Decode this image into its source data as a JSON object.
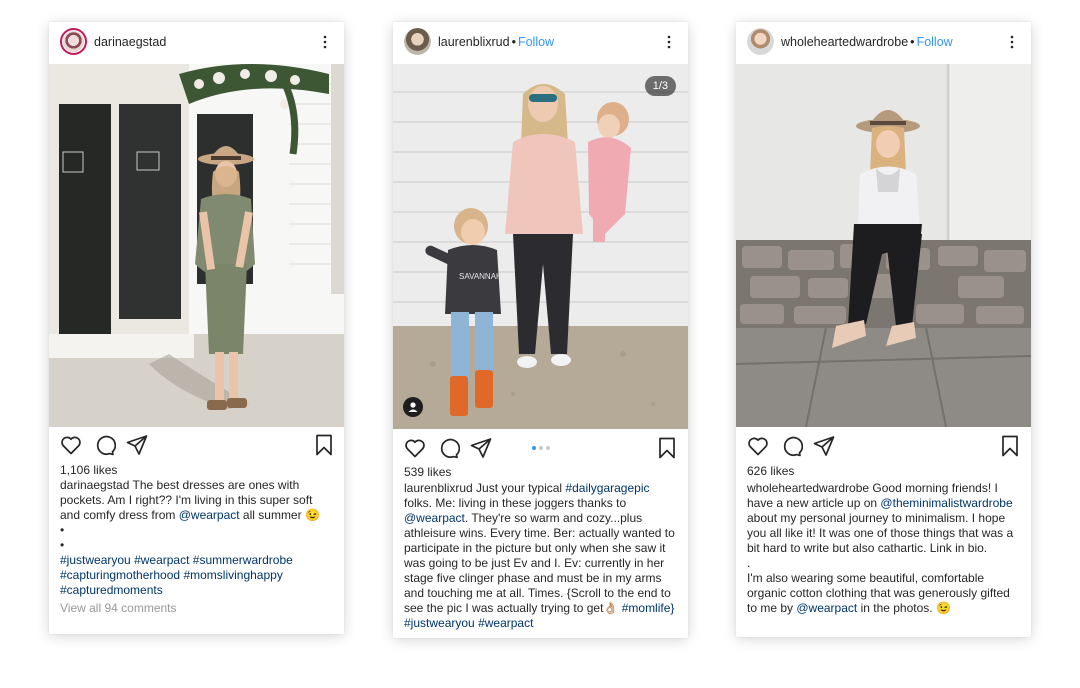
{
  "posts": [
    {
      "username": "darinaegstad",
      "follow": "",
      "likes": "1,106 likes",
      "caption": {
        "user": "darinaegstad",
        "t1": " The best dresses are ones with pockets. Am I right?? I'm living in this super soft and comfy dress from ",
        "mention": "@wearpact",
        "t2": " all summer 😉",
        "dot1": "•",
        "dot2": "•",
        "tags": [
          "#justwearyou",
          "#wearpact",
          "#summerwardrobe",
          "#capturingmotherhood",
          "#momslivinghappy",
          "#capturedmoments"
        ]
      },
      "comments": "View all 94 comments"
    },
    {
      "username": "laurenblixrud",
      "follow": "Follow",
      "counter": "1/3",
      "likes": "539 likes",
      "caption": {
        "user": "laurenblixrud",
        "t1": " Just your typical ",
        "tag1": "#dailygaragepic",
        "t2": " folks. Me: living in these joggers thanks to ",
        "mention": "@wearpact",
        "t3": ". They're so warm and cozy...plus athleisure wins. Every time. Ber: actually wanted to participate in the picture but only when she saw it was going to be just Ev and I. Ev: currently in her stage five clinger phase and must be in my arms and touching me at all. Times. {Scroll to the end to see the pic I was actually trying to get👌🏼 ",
        "tag2": "#momlife}",
        "t4": " ",
        "tag3": "#justwearyou",
        "t5": " ",
        "tag4": "#wearpact"
      }
    },
    {
      "username": "wholeheartedwardrobe",
      "follow": "Follow",
      "likes": "626 likes",
      "caption": {
        "user": "wholeheartedwardrobe",
        "t1": " Good morning friends! I have a new article up on ",
        "mention1": "@theminimalistwardrobe",
        "t2": " about my personal journey to minimalism. I hope you all like it! It was one of those things that was a bit hard to write but also cathartic. Link in bio.",
        "dot": ".",
        "t3": "I'm also wearing some beautiful, comfortable organic cotton clothing that was generously gifted to me by ",
        "mention2": "@wearpact",
        "t4": " in the photos. 😉"
      }
    }
  ],
  "colors": {
    "link": "#3897f0",
    "hashtag": "#003569",
    "text": "#262626",
    "muted": "#999999"
  },
  "icons": [
    "heart-icon",
    "comment-icon",
    "share-icon",
    "bookmark-icon",
    "more-icon",
    "user-tag-icon"
  ]
}
